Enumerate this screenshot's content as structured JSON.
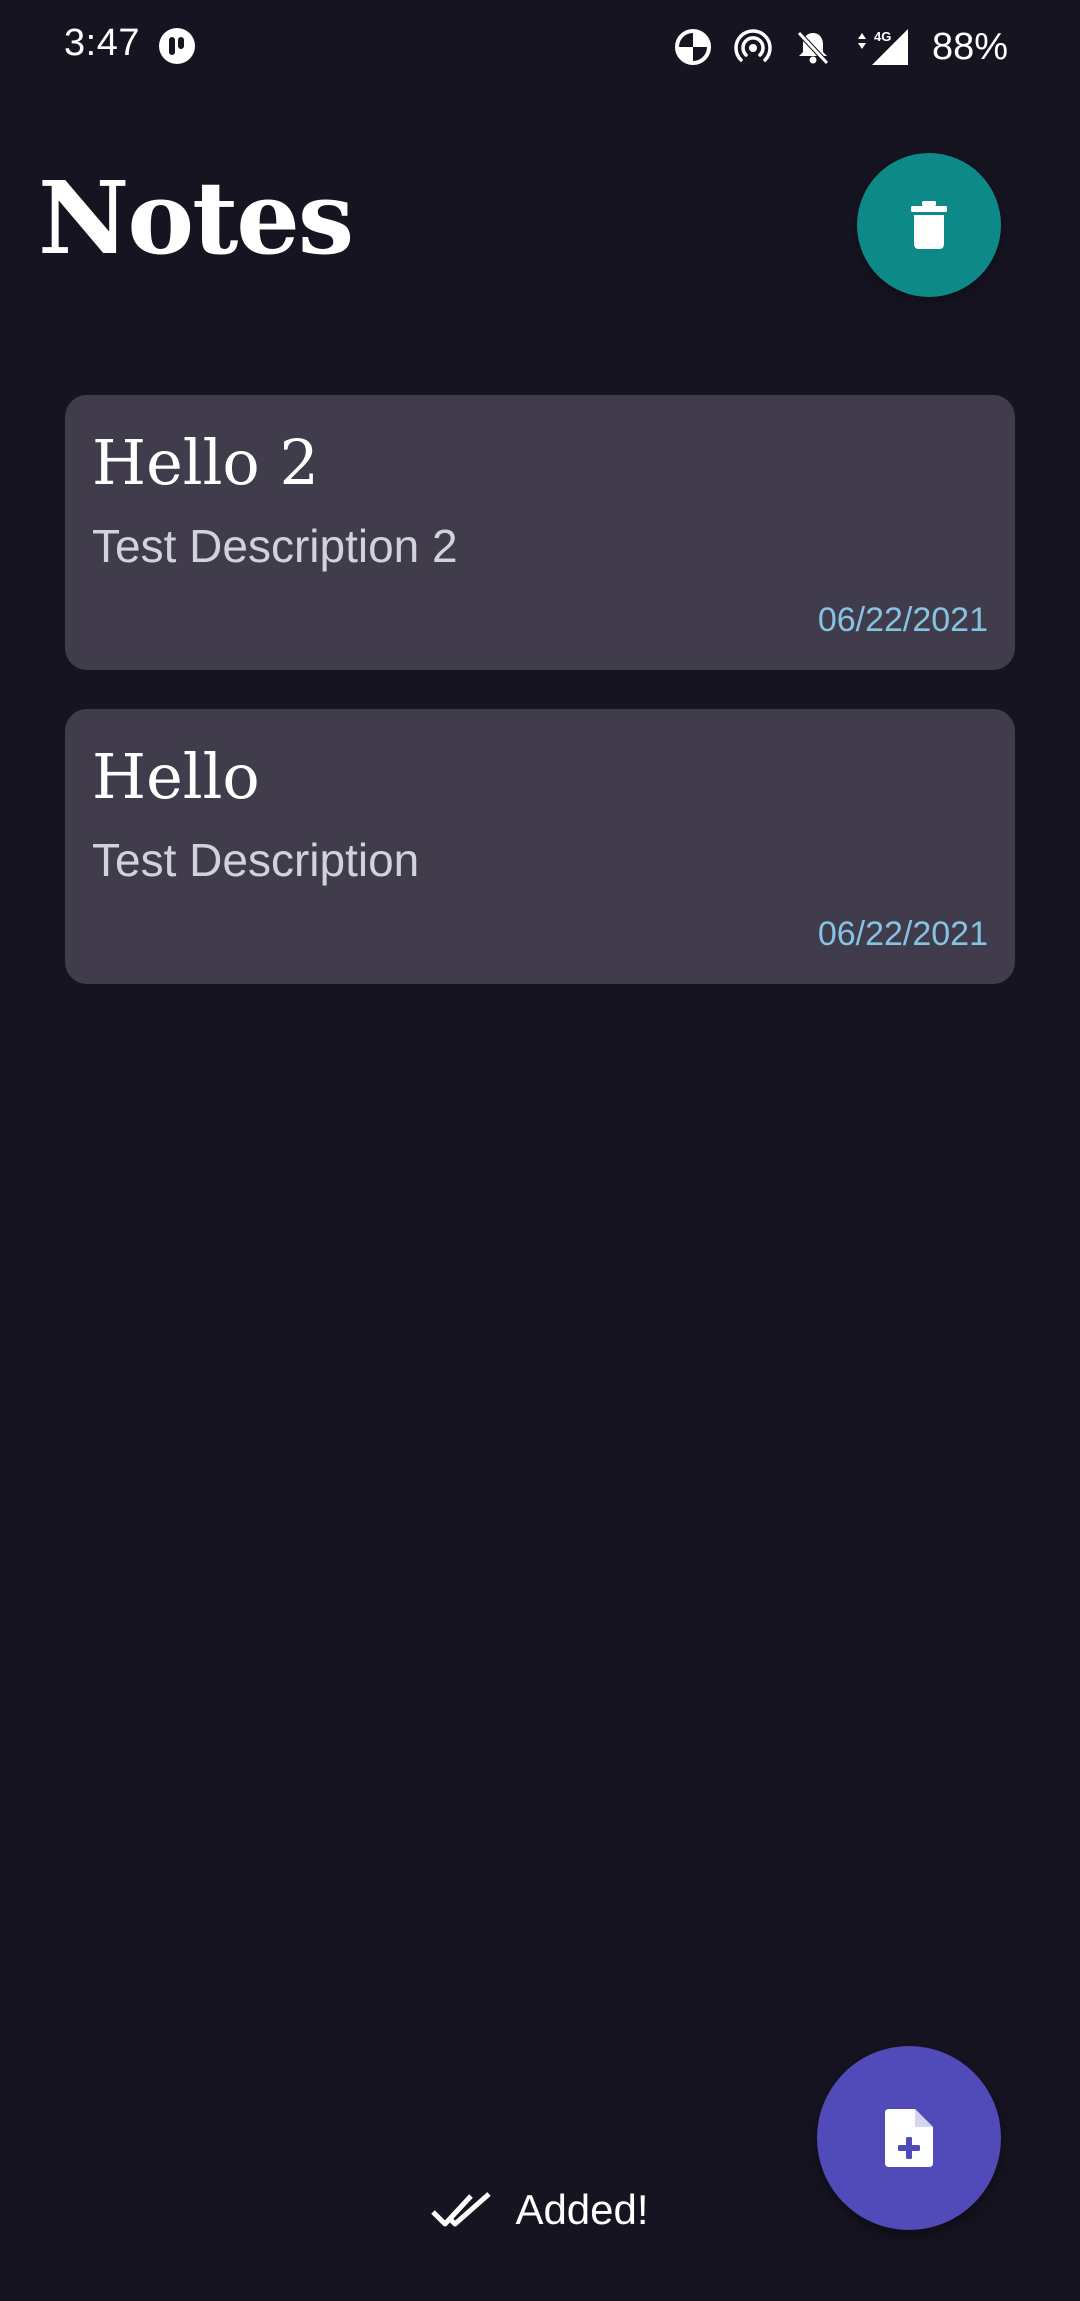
{
  "status_bar": {
    "time": "3:47",
    "battery": "88%",
    "network_label": "4G",
    "icons": [
      "app-notification-icon",
      "data-saver-icon",
      "hotspot-icon",
      "bell-off-icon",
      "signal-4g-icon"
    ]
  },
  "header": {
    "title": "Notes",
    "delete_icon": "trash-icon"
  },
  "notes": [
    {
      "title": "Hello 2",
      "description": "Test Description 2",
      "date": "06/22/2021"
    },
    {
      "title": "Hello",
      "description": "Test Description",
      "date": "06/22/2021"
    }
  ],
  "fab": {
    "icon": "add-note-icon"
  },
  "toast": {
    "icon": "double-check-icon",
    "text": "Added!"
  },
  "colors": {
    "background": "#161421",
    "card": "#403c4c",
    "delete_fab": "#0d8a87",
    "add_fab": "#514bb9",
    "date_text": "#86c3e3"
  }
}
